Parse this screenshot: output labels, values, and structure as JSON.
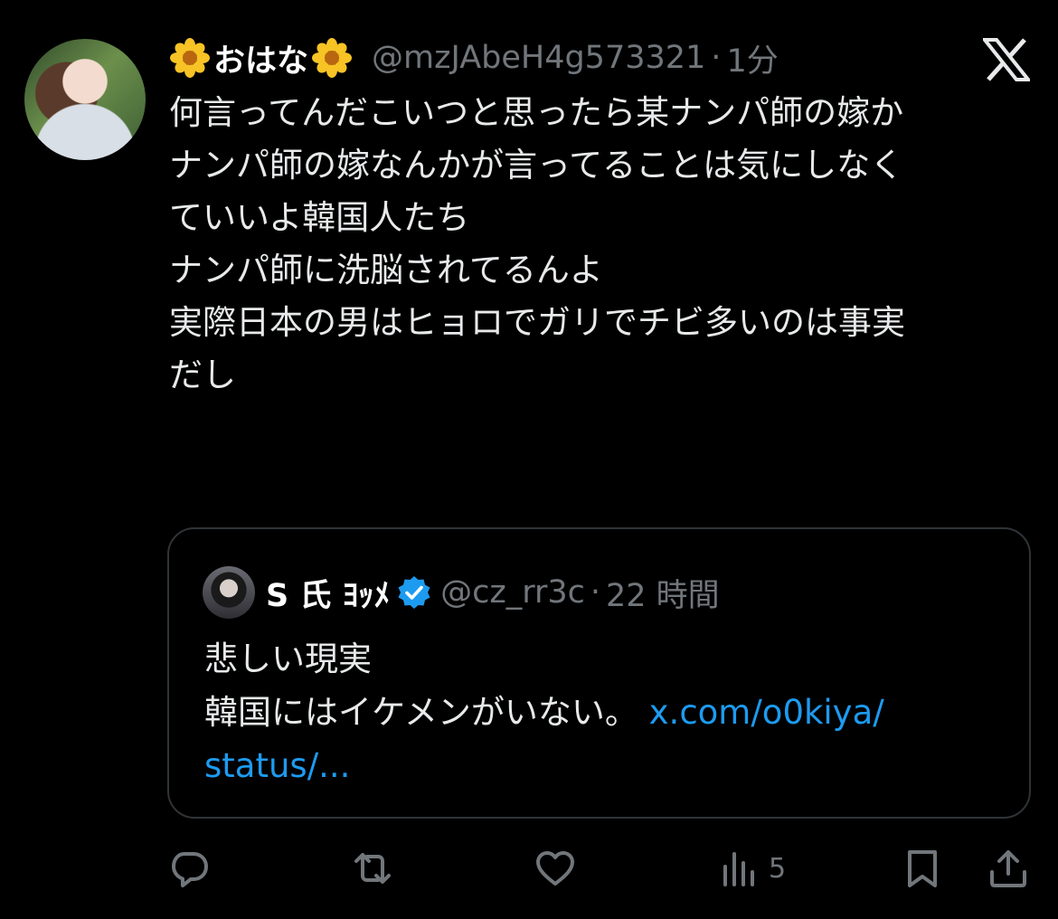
{
  "tweet": {
    "display_name": "おはな",
    "handle": "@mzJAbeH4g573321",
    "separator": "·",
    "time": "1分",
    "lines": [
      "何言ってんだこいつと思ったら某ナンパ師の嫁か",
      "",
      "ナンパ師の嫁なんかが言ってることは気にしなく",
      "ていいよ韓国人たち",
      "ナンパ師に洗脳されてるんよ",
      "",
      "実際日本の男はヒョロでガリでチビ多いのは事実",
      "だし"
    ]
  },
  "quote": {
    "display_name": "S 氏 ﾖｯﾒ",
    "handle": "@cz_rr3c",
    "separator": "·",
    "time": "22 時間",
    "line1": "悲しい現実",
    "line2": "韓国にはイケメンがいない。",
    "link1": "x.com/o0kiya/",
    "link2": "status/..."
  },
  "actions": {
    "views_count": "5"
  },
  "colors": {
    "background": "#000000",
    "text": "#e7e9ea",
    "muted": "#71767b",
    "link": "#1d9bf0",
    "verified": "#1d9bf0",
    "border": "#2f3336"
  },
  "icons": [
    "flower-emoji-icon",
    "x-logo-icon",
    "verified-badge-icon",
    "reply-icon",
    "retweet-icon",
    "like-icon",
    "views-icon",
    "bookmark-icon",
    "share-icon"
  ]
}
